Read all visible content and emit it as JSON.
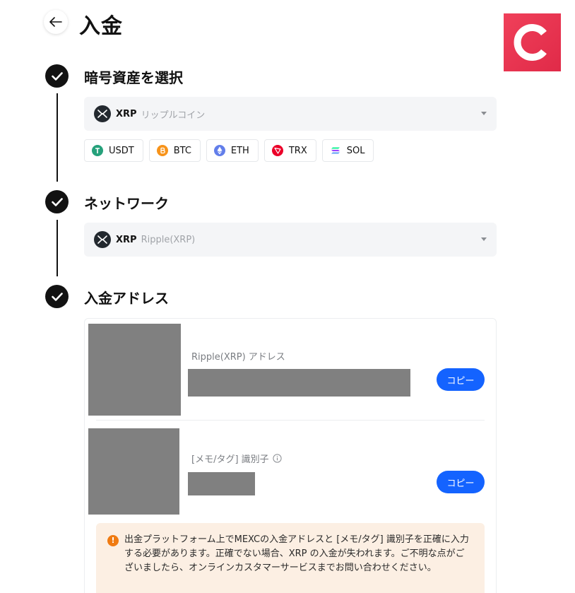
{
  "header": {
    "title": "入金"
  },
  "steps": [
    {
      "title": "暗号資産を選択"
    },
    {
      "title": "ネットワーク"
    },
    {
      "title": "入金アドレス"
    }
  ],
  "coin_select": {
    "symbol": "XRP",
    "description": "リップルコイン"
  },
  "quick_coins": [
    {
      "label": "USDT",
      "color": "#26a17b"
    },
    {
      "label": "BTC",
      "color": "#f7931a"
    },
    {
      "label": "ETH",
      "color": "#627eea"
    },
    {
      "label": "TRX",
      "color": "#eb0029"
    },
    {
      "label": "SOL",
      "color": "#9945ff"
    }
  ],
  "network_select": {
    "symbol": "XRP",
    "description": "Ripple(XRP)"
  },
  "address": {
    "address_label": "Ripple(XRP) アドレス",
    "memo_label": "[メモ/タグ] 識別子",
    "copy_label": "コピー",
    "warning_icon": "!",
    "warning_text": "出金プラットフォーム上でMEXCの入金アドレスと [メモ/タグ] 識別子を正確に入力する必要があります。正確でない場合、XRP の入金が失われます。ご不明な点がございましたら、オンラインカスタマーサービスまでお問い合わせください。"
  },
  "colors": {
    "accent": "#1463ff",
    "logo": "#e8344f",
    "warning_bg": "#fcefe3"
  }
}
